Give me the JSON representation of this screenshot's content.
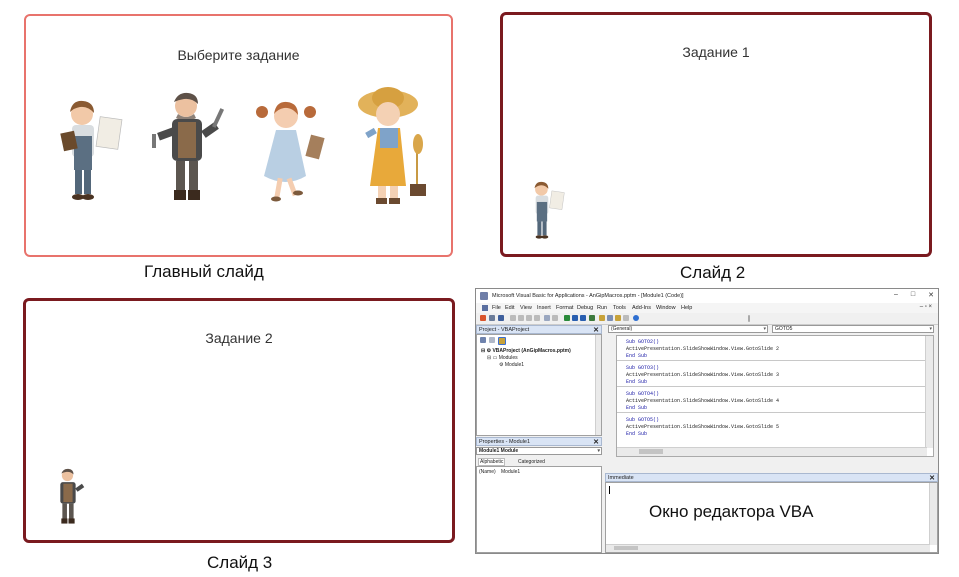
{
  "slides": [
    {
      "title": "Выберите задание",
      "caption": "Главный слайд"
    },
    {
      "title": "Задание 1",
      "caption": "Слайд 2"
    },
    {
      "title": "Задание 2",
      "caption": "Слайд 3"
    }
  ],
  "characters": [
    "boy-with-clipboard-icon",
    "mechanic-with-tools-icon",
    "girl-with-clipboard-icon",
    "farmer-girl-with-wheat-icon"
  ],
  "vba_editor": {
    "window_title": "Microsoft Visual Basic for Applications - AnGipMacros.pptm - [Module1 (Code)]",
    "menu": [
      "File",
      "Edit",
      "View",
      "Insert",
      "Format",
      "Debug",
      "Run",
      "Tools",
      "Add-Ins",
      "Window",
      "Help"
    ],
    "project_pane": {
      "title": "Project - VBAProject",
      "tree": [
        "VBAProject (AnGipMacros.pptm)",
        "Modules",
        "Module1"
      ]
    },
    "properties_pane": {
      "title": "Properties - Module1",
      "object_combo": "Module1 Module",
      "tabs": [
        "Alphabetic",
        "Categorized"
      ],
      "property_row": {
        "name": "(Name)",
        "value": "Module1"
      }
    },
    "object_combo": "(General)",
    "procedure_combo": "GOTO5",
    "code_lines": [
      "Sub GOTO2()",
      "ActivePresentation.SlideShowWindow.View.GotoSlide 2",
      "End Sub",
      "Sub GOTO3()",
      "ActivePresentation.SlideShowWindow.View.GotoSlide 3",
      "End Sub",
      "Sub GOTO4()",
      "ActivePresentation.SlideShowWindow.View.GotoSlide 4",
      "End Sub",
      "Sub GOTO5()",
      "ActivePresentation.SlideShowWindow.View.GotoSlide 5",
      "End Sub"
    ],
    "immediate_title": "Immediate",
    "label": "Окно редактора VBA"
  },
  "colors": {
    "slide1_border": "#e8736c",
    "slide_border": "#7a1a1f",
    "keyword": "#1a1aa6"
  }
}
